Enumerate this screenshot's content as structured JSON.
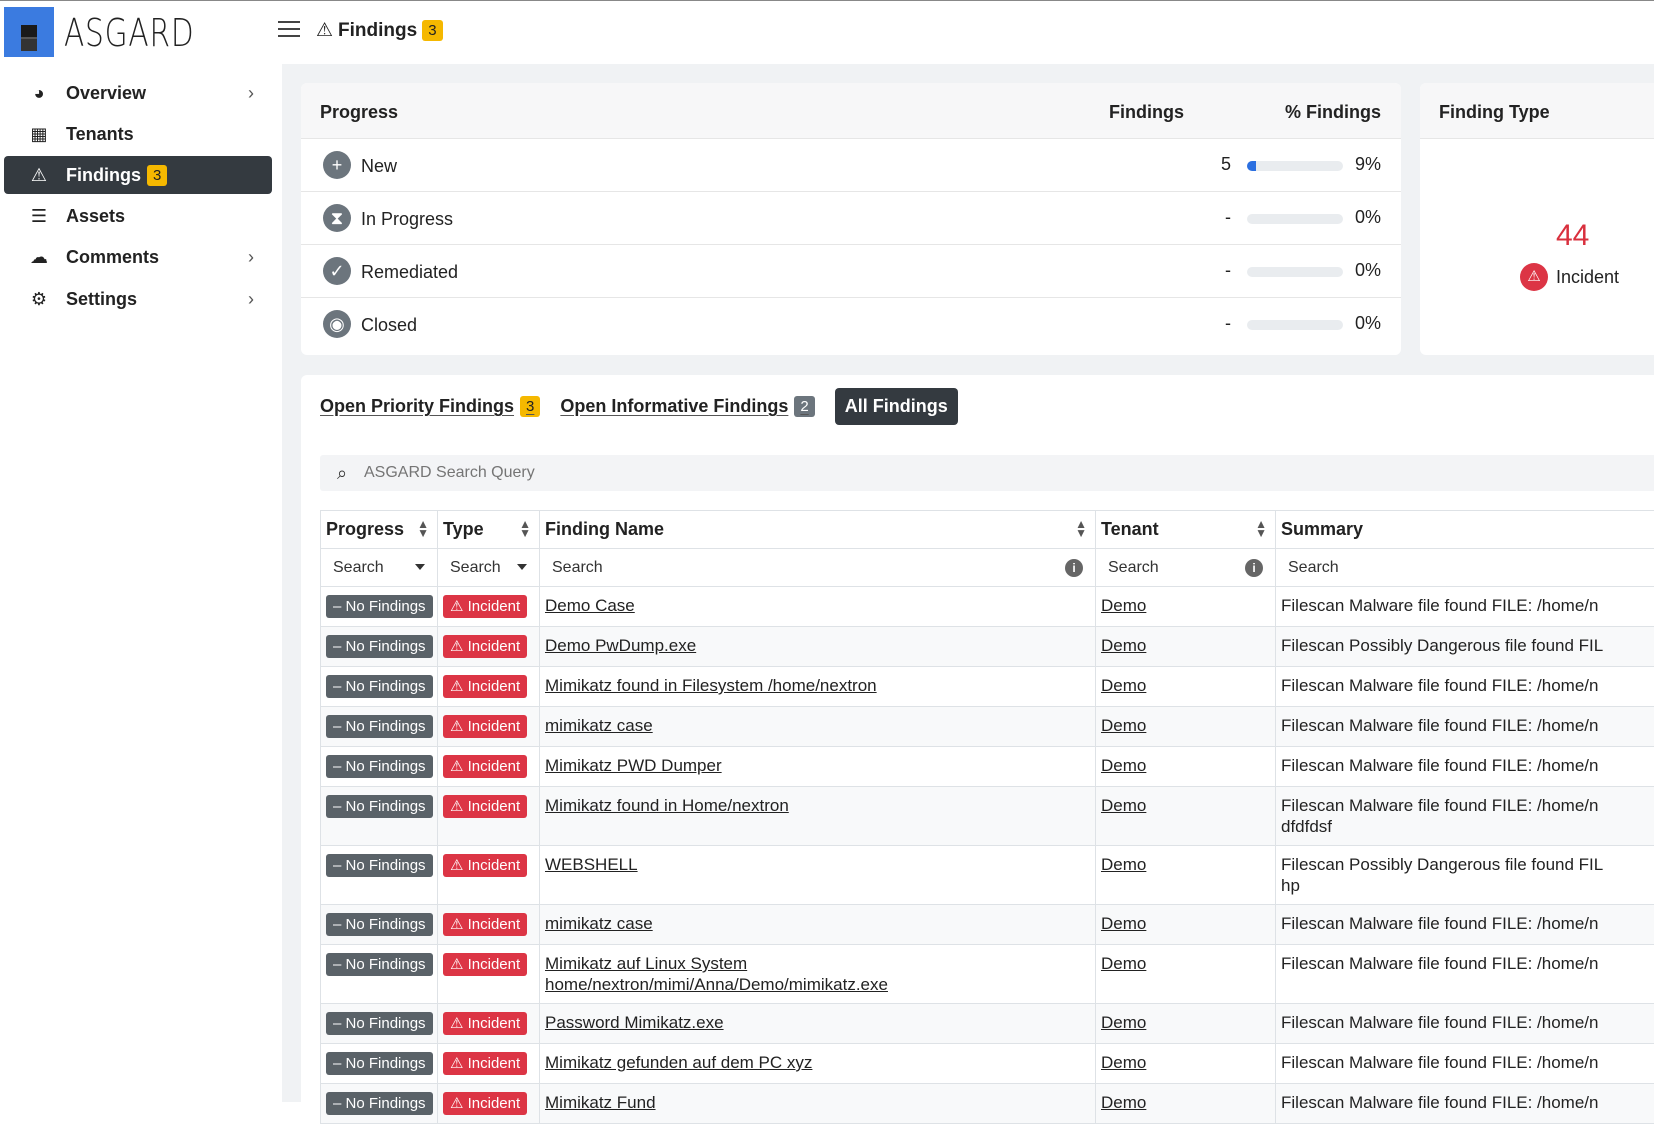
{
  "app": {
    "brand": "ASGARD"
  },
  "topbar": {
    "title": "Findings",
    "badge": "3"
  },
  "sidebar": {
    "items": [
      {
        "label": "Overview",
        "icon": "palette-icon"
      },
      {
        "label": "Tenants",
        "icon": "building-icon"
      },
      {
        "label": "Findings",
        "icon": "warning-icon",
        "badge": "3"
      },
      {
        "label": "Assets",
        "icon": "server-icon"
      },
      {
        "label": "Comments",
        "icon": "comments-icon"
      },
      {
        "label": "Settings",
        "icon": "cogs-icon"
      }
    ]
  },
  "progress": {
    "headers": {
      "progress": "Progress",
      "findings": "Findings",
      "pct": "% Findings"
    },
    "rows": [
      {
        "label": "New",
        "count": "5",
        "pct": "9%",
        "fill": 0.09,
        "icon": "plus-circle-icon"
      },
      {
        "label": "In Progress",
        "count": "-",
        "pct": "0%",
        "fill": 0,
        "icon": "hourglass-icon"
      },
      {
        "label": "Remediated",
        "count": "-",
        "pct": "0%",
        "fill": 0,
        "icon": "check-circle-icon"
      },
      {
        "label": "Closed",
        "count": "-",
        "pct": "0%",
        "fill": 0,
        "icon": "closed-eye-icon"
      }
    ]
  },
  "finding_type": {
    "title": "Finding Type",
    "count": "44",
    "label": "Incident"
  },
  "tabs": [
    {
      "label": "Open Priority Findings",
      "badge": "3"
    },
    {
      "label": "Open Informative Findings",
      "badge": "2"
    },
    {
      "label": "All Findings"
    }
  ],
  "search": {
    "placeholder": "ASGARD Search Query"
  },
  "table": {
    "columns": [
      "Progress",
      "Type",
      "Finding Name",
      "Tenant",
      "Summary"
    ],
    "filter_placeholder": "Search",
    "progress_label": "No Findings",
    "type_label": "Incident",
    "rows": [
      {
        "name": "Demo Case",
        "tenant": "Demo",
        "summary": "Filescan Malware file found FILE: /home/n"
      },
      {
        "name": "Demo PwDump.exe",
        "tenant": "Demo",
        "summary": "Filescan Possibly Dangerous file found FIL"
      },
      {
        "name": "Mimikatz found in Filesystem /home/nextron",
        "tenant": "Demo",
        "summary": "Filescan Malware file found FILE: /home/n"
      },
      {
        "name": "mimikatz case",
        "tenant": "Demo",
        "summary": "Filescan Malware file found FILE: /home/n"
      },
      {
        "name": "Mimikatz PWD Dumper",
        "tenant": "Demo",
        "summary": "Filescan Malware file found FILE: /home/n"
      },
      {
        "name": "Mimikatz found in Home/nextron",
        "tenant": "Demo",
        "summary": "Filescan Malware file found FILE: /home/n\ndfdfdsf"
      },
      {
        "name": "WEBSHELL",
        "tenant": "Demo",
        "summary": "Filescan Possibly Dangerous file found FIL\nhp"
      },
      {
        "name": "mimikatz case",
        "tenant": "Demo",
        "summary": "Filescan Malware file found FILE: /home/n"
      },
      {
        "name": "Mimikatz auf Linux System home/nextron/mimi/Anna/Demo/mimikatz.exe",
        "tenant": "Demo",
        "summary": "Filescan Malware file found FILE: /home/n"
      },
      {
        "name": "Password Mimikatz.exe",
        "tenant": "Demo",
        "summary": "Filescan Malware file found FILE: /home/n"
      },
      {
        "name": "Mimikatz gefunden auf dem PC xyz",
        "tenant": "Demo",
        "summary": "Filescan Malware file found FILE: /home/n"
      },
      {
        "name": "Mimikatz Fund",
        "tenant": "Demo",
        "summary": "Filescan Malware file found FILE: /home/n"
      }
    ]
  },
  "colors": {
    "accent": "#2b6fe0",
    "danger": "#dc3545",
    "warning": "#f5b800",
    "dark": "#343a40"
  }
}
